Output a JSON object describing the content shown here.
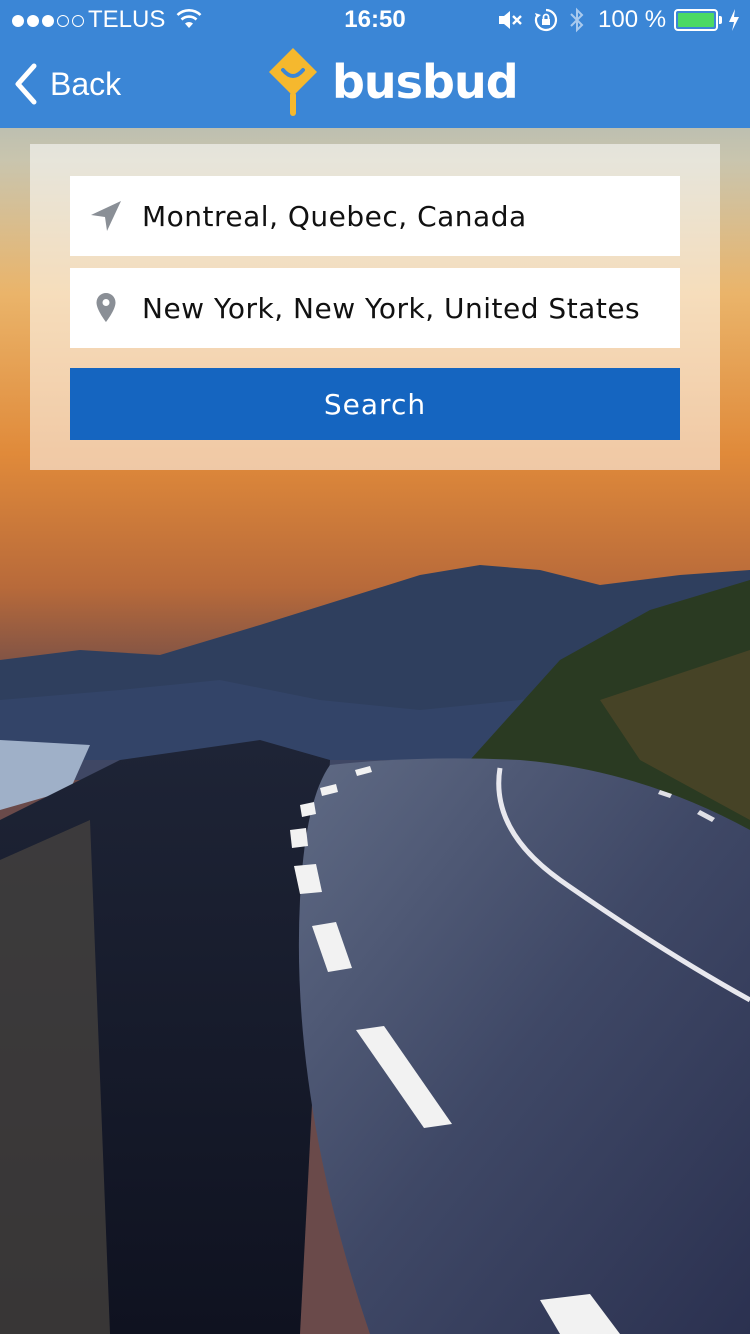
{
  "status_bar": {
    "carrier": "TELUS",
    "time": "16:50",
    "battery": "100 %"
  },
  "nav": {
    "back_label": "Back",
    "logo_text": "busbud"
  },
  "search": {
    "from_value": "Montreal, Quebec, Canada",
    "to_value": "New York, New York, United States",
    "button_label": "Search"
  },
  "colors": {
    "header": "#3b86d6",
    "button": "#1565c0",
    "logo_accent": "#f5b82e",
    "battery": "#4cd964"
  },
  "icons": [
    "wifi-icon",
    "mute-icon",
    "rotation-lock-icon",
    "bluetooth-icon",
    "battery-icon",
    "back-chevron-icon",
    "location-arrow-icon",
    "map-pin-icon"
  ]
}
